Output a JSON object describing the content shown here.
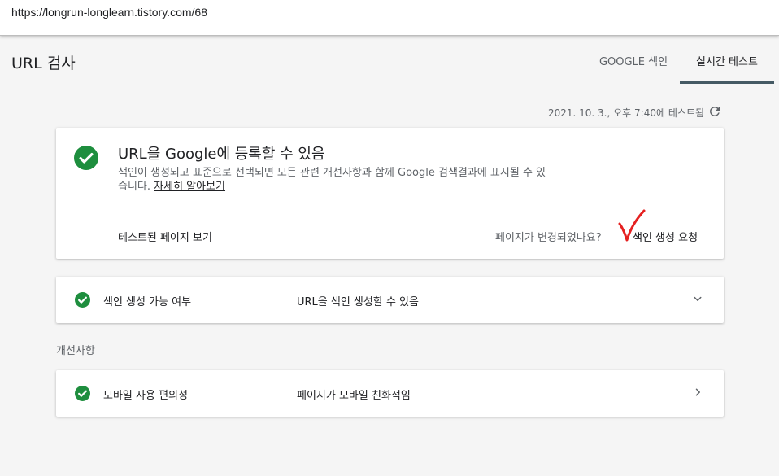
{
  "browser": {
    "url": "https://longrun-longlearn.tistory.com/68"
  },
  "header": {
    "title": "URL 검사",
    "tabs": [
      {
        "label": "GOOGLE 색인",
        "active": false
      },
      {
        "label": "실시간 테스트",
        "active": true
      }
    ]
  },
  "test_status": {
    "timestamp": "2021. 10. 3., 오후 7:40에 테스트됨",
    "icon": "refresh-icon"
  },
  "main_card": {
    "status_icon": "check-circle-icon",
    "title": "URL을 Google에 등록할 수 있음",
    "description": "색인이 생성되고 표준으로 선택되면 모든 관련 개선사항과 함께 Google 검색결과에 표시될 수 있습니다.",
    "learn_more": "자세히 알아보기",
    "view_tested_page": "테스트된 페이지 보기",
    "page_changed": "페이지가 변경되었나요?",
    "request_indexing": "색인 생성 요청"
  },
  "indexability": {
    "label": "색인 생성 가능 여부",
    "value": "URL을 색인 생성할 수 있음",
    "icon": "check-circle-icon",
    "arrow": "chevron-down-icon"
  },
  "enhancements": {
    "section_title": "개선사항",
    "items": [
      {
        "label": "모바일 사용 편의성",
        "value": "페이지가 모바일 친화적임",
        "icon": "check-circle-icon",
        "arrow": "chevron-right-icon"
      }
    ]
  },
  "colors": {
    "success": "#1e8e3e",
    "annotation": "#e52020",
    "tab_indicator": "#455a64"
  }
}
